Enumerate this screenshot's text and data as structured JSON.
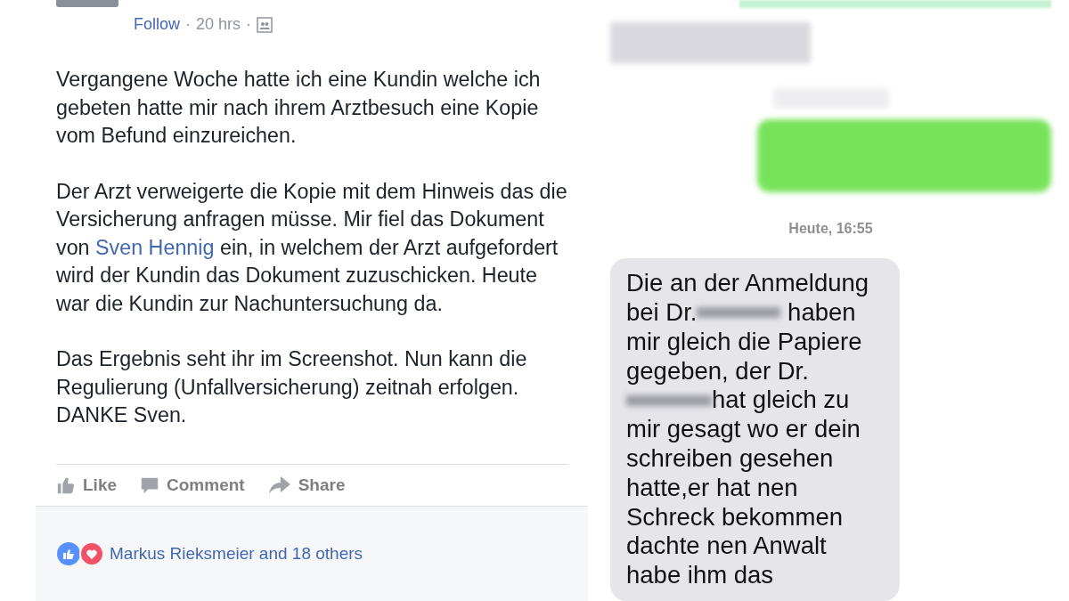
{
  "post": {
    "follow": "Follow",
    "separator": "·",
    "time": "20 hrs",
    "paragraphs": [
      {
        "parts": [
          {
            "kind": "text",
            "text": "Vergangene Woche hatte ich eine Kundin welche ich gebeten hatte mir nach ihrem Arztbesuch eine Kopie vom Befund einzureichen."
          }
        ]
      },
      {
        "parts": [
          {
            "kind": "text",
            "text": "Der Arzt verweigerte die Kopie mit dem Hinweis das die Versicherung anfragen müsse. Mir fiel das Dokument von "
          },
          {
            "kind": "link",
            "text": "Sven Hennig"
          },
          {
            "kind": "text",
            "text": " ein, in welchem der Arzt aufgefordert wird der Kundin das Dokument zuzuschicken. Heute war die Kundin zur Nachuntersuchung da."
          }
        ]
      },
      {
        "parts": [
          {
            "kind": "text",
            "text": "Das Ergebnis seht ihr im Screenshot. Nun kann die Regulierung (Unfallversicherung) zeitnah erfolgen. DANKE Sven."
          }
        ]
      }
    ],
    "actions": [
      {
        "kind": "like",
        "label": "Like"
      },
      {
        "kind": "comment",
        "label": "Comment"
      },
      {
        "kind": "share",
        "label": "Share"
      }
    ],
    "reactions": "Markus Rieksmeier and 18 others"
  },
  "chat": {
    "timestamp": "Heute, 16:55",
    "message": [
      [
        {
          "kind": "text",
          "text": "Die an der Anmeldung"
        }
      ],
      [
        {
          "kind": "text",
          "text": "bei Dr."
        },
        {
          "kind": "redacted"
        },
        {
          "kind": "text",
          "text": " haben"
        }
      ],
      [
        {
          "kind": "text",
          "text": "mir gleich die Papiere"
        }
      ],
      [
        {
          "kind": "text",
          "text": "gegeben, der Dr."
        }
      ],
      [
        {
          "kind": "redacted"
        },
        {
          "kind": "text",
          "text": "hat gleich zu"
        }
      ],
      [
        {
          "kind": "text",
          "text": "mir gesagt wo er dein"
        }
      ],
      [
        {
          "kind": "text",
          "text": "schreiben gesehen"
        }
      ],
      [
        {
          "kind": "text",
          "text": "hatte,er hat nen"
        }
      ],
      [
        {
          "kind": "text",
          "text": "Schreck bekommen"
        }
      ],
      [
        {
          "kind": "text",
          "text": "dachte nen Anwalt"
        }
      ],
      [
        {
          "kind": "text",
          "text": "habe ihm das"
        }
      ]
    ]
  }
}
